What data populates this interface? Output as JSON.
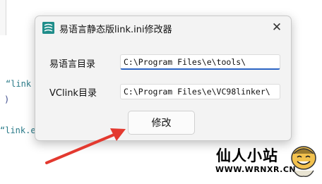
{
  "background_code": {
    "line1": "“link",
    "line2": ")",
    "line3": "“link.e"
  },
  "dialog": {
    "title": "易语言静态版link.ini修改器",
    "close_glyph": "✕",
    "rows": [
      {
        "label": "易语言目录",
        "value": "C:\\Program Files\\e\\tools\\"
      },
      {
        "label": "VClink目录",
        "value": "C:\\Program Files\\e\\VC98linker\\"
      }
    ],
    "modify_label": "修改"
  },
  "watermark": {
    "title": "仙人小站",
    "url": "WWW.WRNXR.CN"
  },
  "colors": {
    "arrow": "#e3392f",
    "accent": "#2b64c4",
    "app_icon": "#1f8d8a"
  },
  "icons": [
    "app-icon",
    "close-icon",
    "arrow-annotation",
    "smiley-mascot-icon"
  ]
}
